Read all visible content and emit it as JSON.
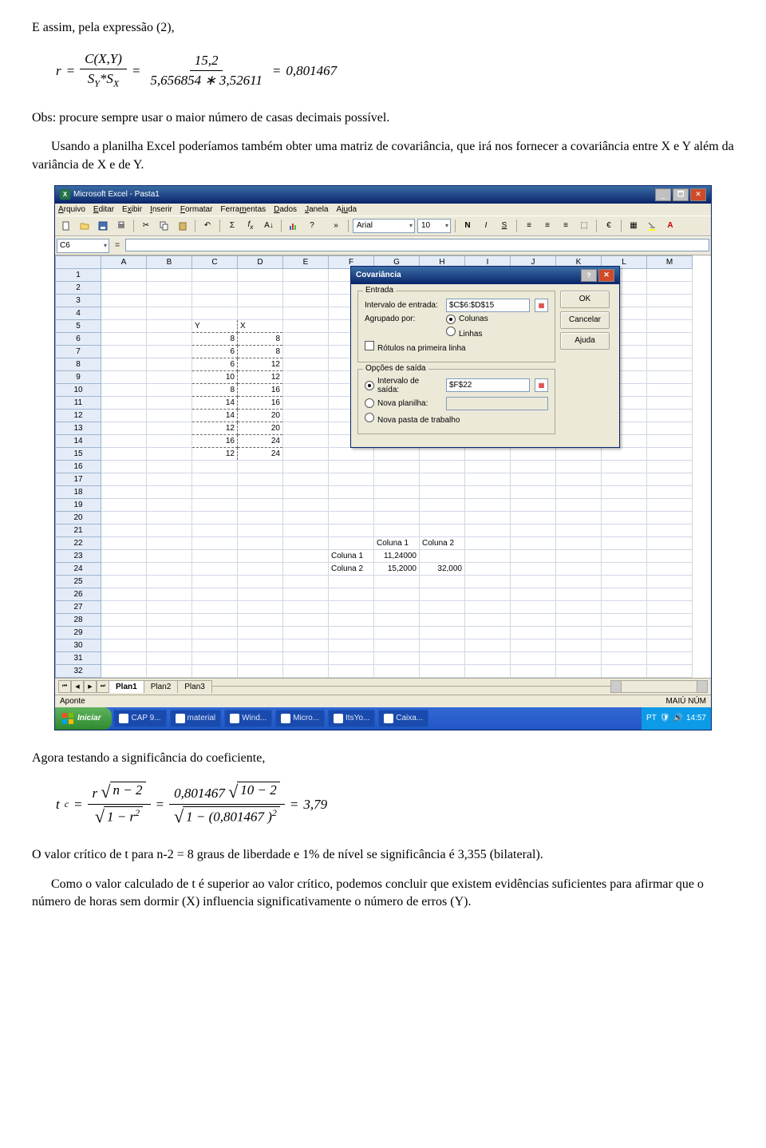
{
  "chart_data": {
    "type": "table",
    "columns": [
      "Y",
      "X"
    ],
    "rows": [
      [
        8,
        8
      ],
      [
        6,
        8
      ],
      [
        6,
        12
      ],
      [
        10,
        12
      ],
      [
        8,
        16
      ],
      [
        14,
        16
      ],
      [
        14,
        20
      ],
      [
        12,
        20
      ],
      [
        16,
        24
      ],
      [
        12,
        24
      ]
    ],
    "covariance_matrix": {
      "columns": [
        "Coluna 1",
        "Coluna 2"
      ],
      "rows": [
        [
          "Coluna 1",
          11.24,
          null
        ],
        [
          "Coluna 2",
          15.2,
          32.0
        ]
      ]
    }
  },
  "text": {
    "p1": "E assim, pela expressão (2),",
    "eq1": {
      "lhs": "r",
      "num1": "C(X,Y)",
      "den1": "S",
      "den1sub1": "Y",
      "den1mid": "*S",
      "den1sub2": "X",
      "num2": "15,2",
      "den2": "5,656854 ∗ 3,52611",
      "rhs": "0,801467"
    },
    "p2": "Obs: procure sempre usar o maior número de casas decimais possível.",
    "p3": "Usando a planilha Excel poderíamos também obter uma matriz de covariância, que irá nos fornecer a covariância entre X e Y além da variância de X e de Y.",
    "p4": "Agora testando a significância do coeficiente,",
    "eq2": {
      "lhs": "t",
      "lhssub": "c",
      "num1a": "r ",
      "rad1a": "n − 2",
      "rad1b": "1 − r",
      "rad1bsup": "2",
      "num2a": "0,801467 ",
      "rad2a": "10 − 2",
      "rad2b": "1 − (0,801467 )",
      "rad2bsup": "2",
      "rhs": "3,79"
    },
    "p5": "O valor crítico de t para n-2 = 8 graus de liberdade e 1% de nível se significância é 3,355 (bilateral).",
    "p6": "Como o valor calculado de t é superior ao valor crítico, podemos concluir que existem evidências suficientes para afirmar que o número de horas sem dormir (X) influencia significativamente o número de erros (Y)."
  },
  "excel": {
    "title": "Microsoft Excel - Pasta1",
    "menu": [
      "Arquivo",
      "Editar",
      "Exibir",
      "Inserir",
      "Formatar",
      "Ferramentas",
      "Dados",
      "Janela",
      "Ajuda"
    ],
    "font_name": "Arial",
    "font_size": "10",
    "active_cell": "C6",
    "formula_value": "=",
    "col_headers": [
      "A",
      "B",
      "C",
      "D",
      "E",
      "F",
      "G",
      "H",
      "I",
      "J",
      "K",
      "L",
      "M"
    ],
    "row_count": 32,
    "data_headers": {
      "y": "Y",
      "x": "X"
    },
    "data_rows": [
      {
        "r": 6,
        "y": "8",
        "x": "8"
      },
      {
        "r": 7,
        "y": "6",
        "x": "8"
      },
      {
        "r": 8,
        "y": "6",
        "x": "12"
      },
      {
        "r": 9,
        "y": "10",
        "x": "12"
      },
      {
        "r": 10,
        "y": "8",
        "x": "16"
      },
      {
        "r": 11,
        "y": "14",
        "x": "16"
      },
      {
        "r": 12,
        "y": "14",
        "x": "20"
      },
      {
        "r": 13,
        "y": "12",
        "x": "20"
      },
      {
        "r": 14,
        "y": "16",
        "x": "24"
      },
      {
        "r": 15,
        "y": "12",
        "x": "24"
      }
    ],
    "cov_header1": "Coluna 1",
    "cov_header2": "Coluna 2",
    "cov_r1_lbl": "Coluna 1",
    "cov_r1_v1": "11,24000",
    "cov_r2_lbl": "Coluna 2",
    "cov_r2_v1": "15,2000",
    "cov_r2_v2": "32,000",
    "sheet_tabs": [
      "Plan1",
      "Plan2",
      "Plan3"
    ],
    "status_left": "Aponte",
    "status_right": "MAIÚ  NÚM"
  },
  "dialog": {
    "title": "Covariância",
    "grp_input": "Entrada",
    "lbl_range": "Intervalo de entrada:",
    "val_range": "$C$6:$D$15",
    "lbl_group": "Agrupado por:",
    "opt_cols": "Colunas",
    "opt_rows": "Linhas",
    "chk_labels": "Rótulos na primeira linha",
    "grp_output": "Opções de saída",
    "opt_out_range": "Intervalo de saída:",
    "val_out": "$F$22",
    "opt_new_sheet": "Nova planilha:",
    "opt_new_book": "Nova pasta de trabalho",
    "btn_ok": "OK",
    "btn_cancel": "Cancelar",
    "btn_help": "Ajuda"
  },
  "taskbar": {
    "start": "Iniciar",
    "items": [
      "CAP 9...",
      "material",
      "Wind...",
      "Micro...",
      "ItsYo...",
      "Caixa..."
    ],
    "lang": "PT",
    "time": "14:57"
  }
}
